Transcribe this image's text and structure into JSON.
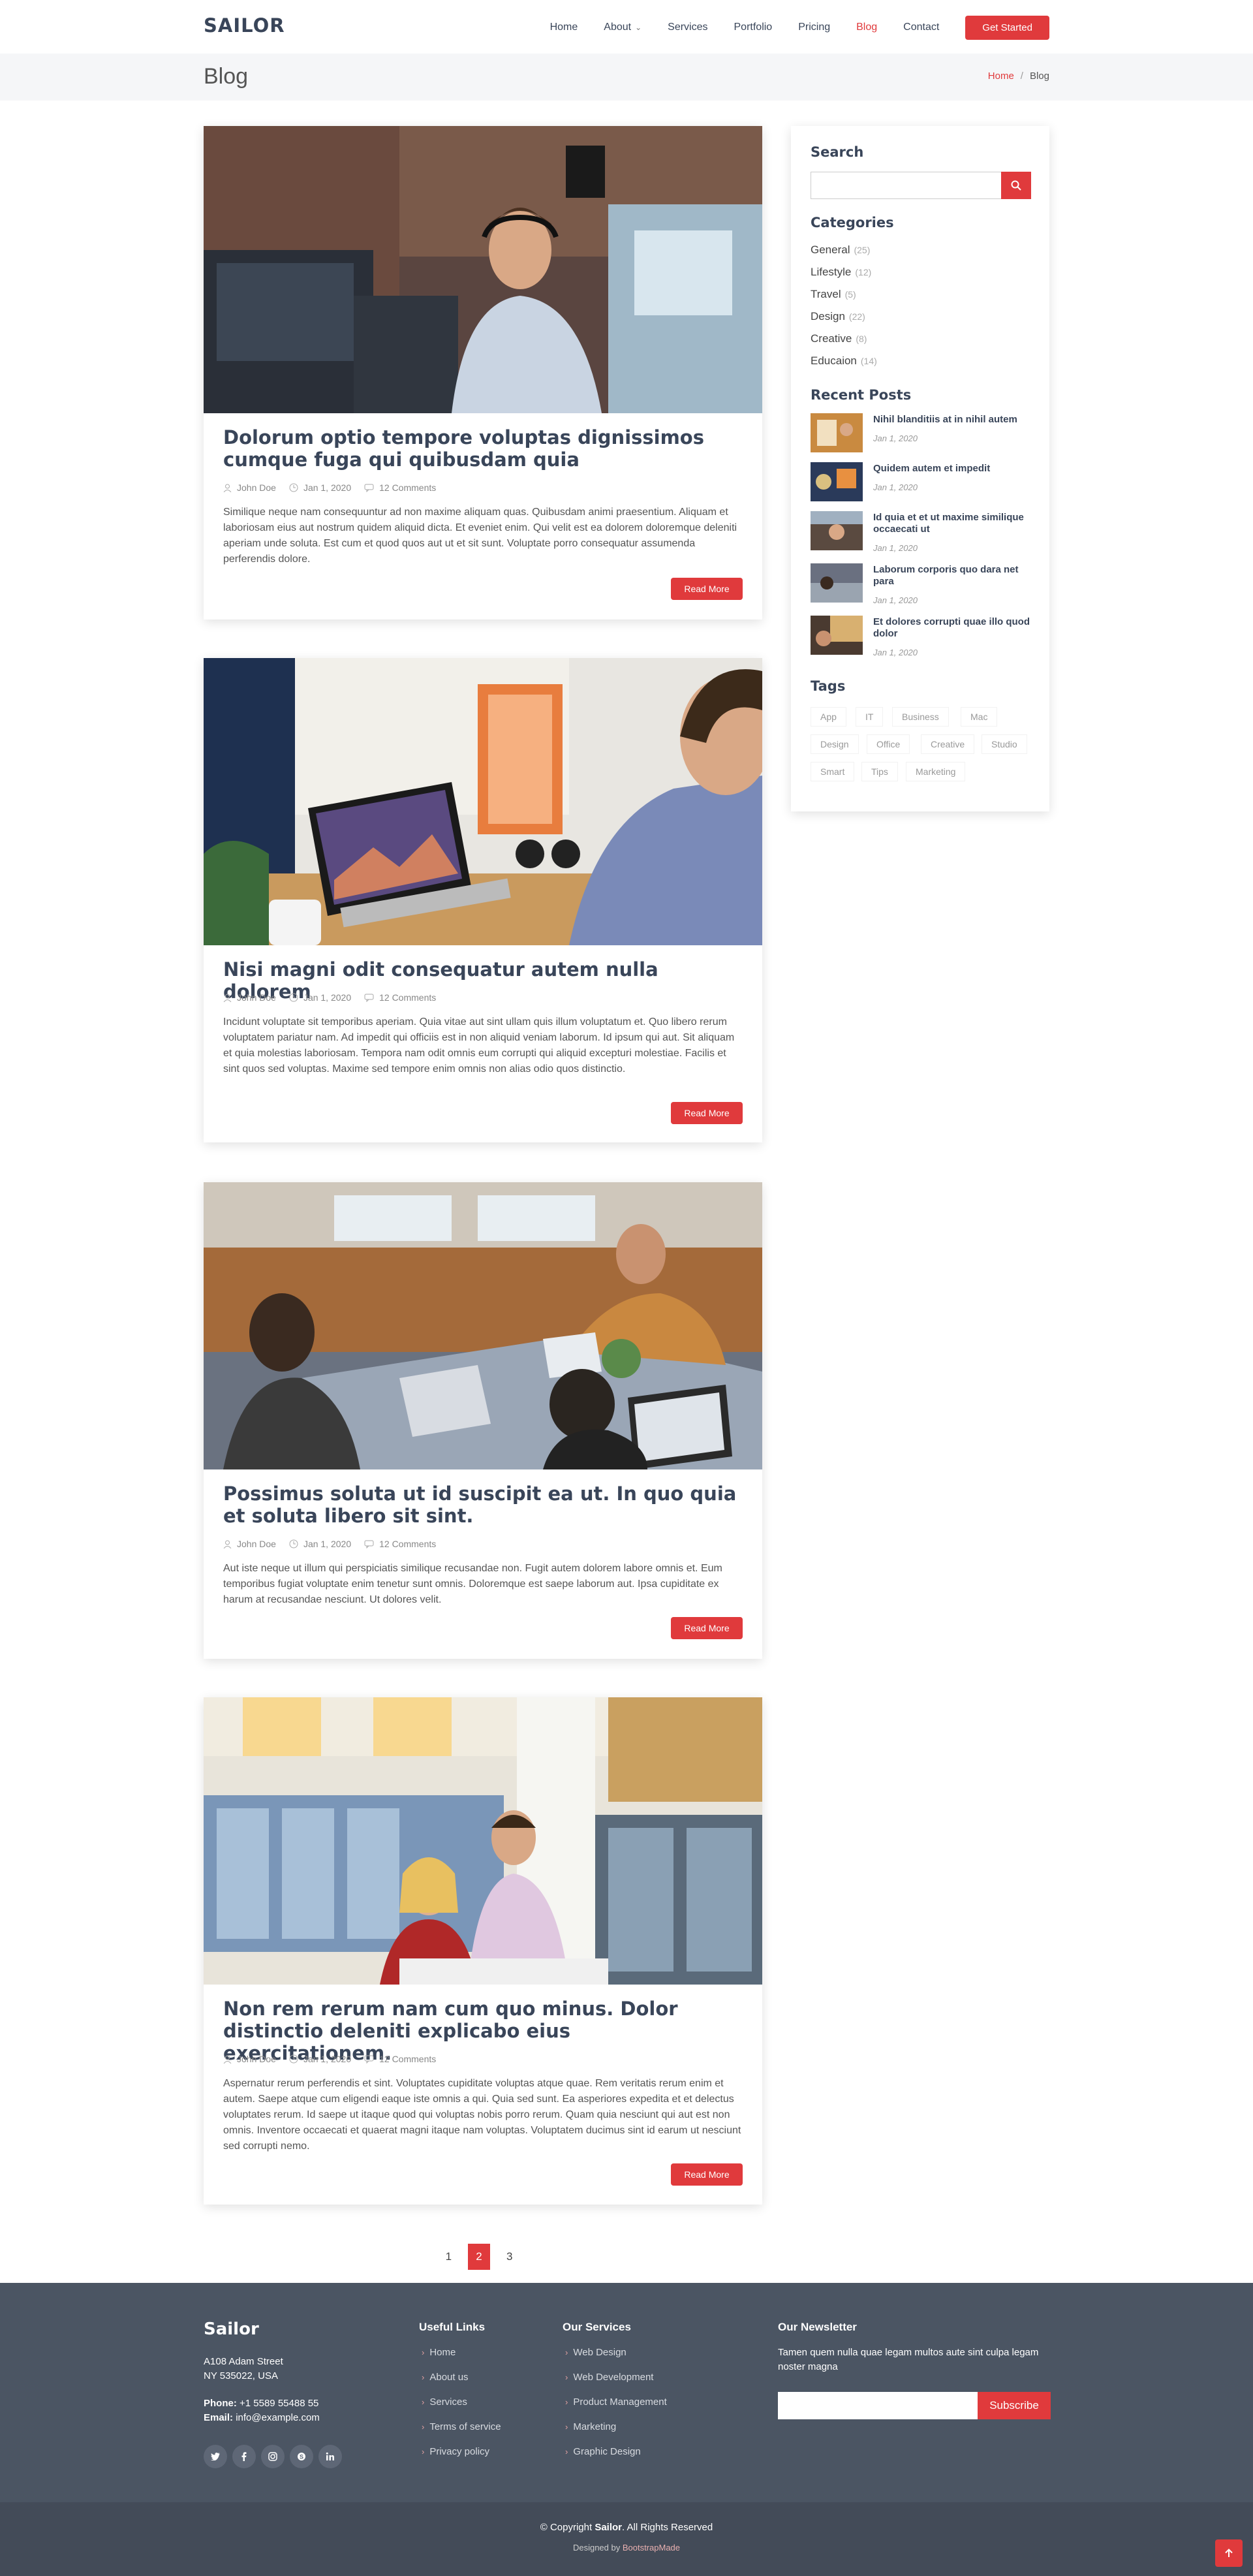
{
  "header": {
    "logo": "SAILOR",
    "nav": [
      "Home",
      "About",
      "Services",
      "Portfolio",
      "Pricing",
      "Blog",
      "Contact"
    ],
    "active_nav": "Blog",
    "cta": "Get Started"
  },
  "breadcrumbs": {
    "title": "Blog",
    "home": "Home",
    "separator": "/",
    "current": "Blog"
  },
  "entries": [
    {
      "title": "Dolorum optio tempore voluptas dignissimos cumque fuga qui quibusdam quia",
      "author": "John Doe",
      "date": "Jan 1, 2020",
      "comments": "12 Comments",
      "excerpt": "Similique neque nam consequuntur ad non maxime aliquam quas. Quibusdam animi praesentium. Aliquam et laboriosam eius aut nostrum quidem aliquid dicta. Et eveniet enim. Qui velit est ea dolorem doloremque deleniti aperiam unde soluta. Est cum et quod quos aut ut et sit sunt. Voluptate porro consequatur assumenda perferendis dolore.",
      "read_more": "Read More"
    },
    {
      "title": "Nisi magni odit consequatur autem nulla dolorem",
      "author": "John Doe",
      "date": "Jan 1, 2020",
      "comments": "12 Comments",
      "excerpt": "Incidunt voluptate sit temporibus aperiam. Quia vitae aut sint ullam quis illum voluptatum et. Quo libero rerum voluptatem pariatur nam. Ad impedit qui officiis est in non aliquid veniam laborum. Id ipsum qui aut. Sit aliquam et quia molestias laboriosam. Tempora nam odit omnis eum corrupti qui aliquid excepturi molestiae. Facilis et sint quos sed voluptas. Maxime sed tempore enim omnis non alias odio quos distinctio.",
      "read_more": "Read More"
    },
    {
      "title": "Possimus soluta ut id suscipit ea ut. In quo quia et soluta libero sit sint.",
      "author": "John Doe",
      "date": "Jan 1, 2020",
      "comments": "12 Comments",
      "excerpt": "Aut iste neque ut illum qui perspiciatis similique recusandae non. Fugit autem dolorem labore omnis et. Eum temporibus fugiat voluptate enim tenetur sunt omnis. Doloremque est saepe laborum aut. Ipsa cupiditate ex harum at recusandae nesciunt. Ut dolores velit.",
      "read_more": "Read More"
    },
    {
      "title": "Non rem rerum nam cum quo minus. Dolor distinctio deleniti explicabo eius exercitationem.",
      "author": "John Doe",
      "date": "Jan 1, 2020",
      "comments": "12 Comments",
      "excerpt": "Aspernatur rerum perferendis et sint. Voluptates cupiditate voluptas atque quae. Rem veritatis rerum enim et autem. Saepe atque cum eligendi eaque iste omnis a qui. Quia sed sunt. Ea asperiores expedita et et delectus voluptates rerum. Id saepe ut itaque quod qui voluptas nobis porro rerum. Quam quia nesciunt qui aut est non omnis. Inventore occaecati et quaerat magni itaque nam voluptas. Voluptatem ducimus sint id earum ut nesciunt sed corrupti nemo.",
      "read_more": "Read More"
    }
  ],
  "sidebar": {
    "search_title": "Search",
    "categories_title": "Categories",
    "categories": [
      {
        "name": "General",
        "count": "(25)"
      },
      {
        "name": "Lifestyle",
        "count": "(12)"
      },
      {
        "name": "Travel",
        "count": "(5)"
      },
      {
        "name": "Design",
        "count": "(22)"
      },
      {
        "name": "Creative",
        "count": "(8)"
      },
      {
        "name": "Educaion",
        "count": "(14)"
      }
    ],
    "recent_title": "Recent Posts",
    "recent": [
      {
        "title": "Nihil blanditiis at in nihil autem",
        "date": "Jan 1, 2020"
      },
      {
        "title": "Quidem autem et impedit",
        "date": "Jan 1, 2020"
      },
      {
        "title": "Id quia et et ut maxime similique occaecati ut",
        "date": "Jan 1, 2020"
      },
      {
        "title": "Laborum corporis quo dara net para",
        "date": "Jan 1, 2020"
      },
      {
        "title": "Et dolores corrupti quae illo quod dolor",
        "date": "Jan 1, 2020"
      }
    ],
    "tags_title": "Tags",
    "tags": [
      "App",
      "IT",
      "Business",
      "Mac",
      "Design",
      "Office",
      "Creative",
      "Studio",
      "Smart",
      "Tips",
      "Marketing"
    ]
  },
  "pagination": [
    "1",
    "2",
    "3"
  ],
  "pagination_active": "2",
  "footer": {
    "brand": "Sailor",
    "address1": "A108 Adam Street",
    "address2": "NY 535022, USA",
    "phone_label": "Phone:",
    "phone": "+1 5589 55488 55",
    "email_label": "Email:",
    "email": "info@example.com",
    "social": [
      "twitter-icon",
      "facebook-icon",
      "instagram-icon",
      "skype-icon",
      "linkedin-icon"
    ],
    "useful_title": "Useful Links",
    "useful": [
      "Home",
      "About us",
      "Services",
      "Terms of service",
      "Privacy policy"
    ],
    "services_title": "Our Services",
    "services": [
      "Web Design",
      "Web Development",
      "Product Management",
      "Marketing",
      "Graphic Design"
    ],
    "newsletter_title": "Our Newsletter",
    "newsletter_text": "Tamen quem nulla quae legam multos aute sint culpa legam noster magna",
    "subscribe": "Subscribe",
    "copyright_pre": "© Copyright",
    "copyright_brand": "Sailor",
    "copyright_post": ". All Rights Reserved",
    "credits_pre": "Designed by",
    "credits_link": "BootstrapMade"
  },
  "colors": {
    "accent": "#e03a3c",
    "heading": "#394559",
    "footer": "#4b5563"
  }
}
